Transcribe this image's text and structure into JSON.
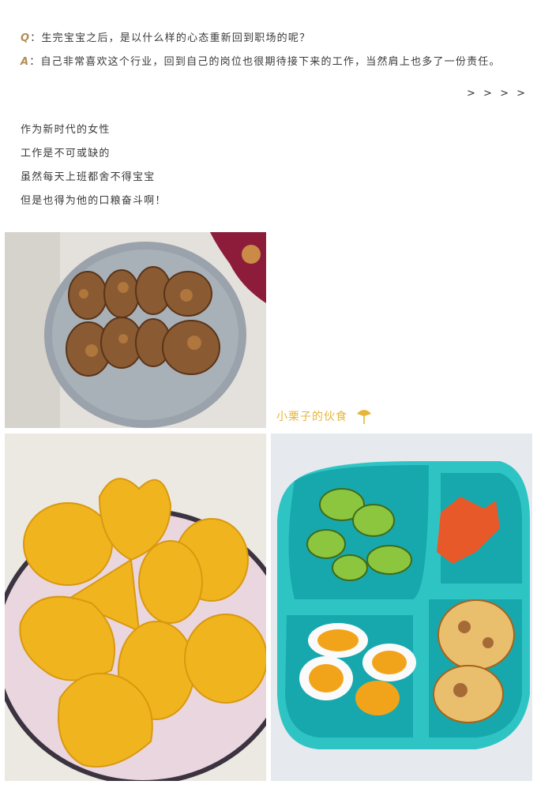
{
  "qa": {
    "q_mark": "Q",
    "q_text": "：生完宝宝之后，是以什么样的心态重新回到职场的呢？",
    "a_mark": "A",
    "a_text": "：自己非常喜欢这个行业，回到自己的岗位也很期待接下来的工作，当然肩上也多了一份责任。",
    "more": "> > > >"
  },
  "lines": [
    "作为新时代的女性",
    "工作是不可或缺的",
    "虽然每天上班都舍不得宝宝",
    "但是也得为他的口粮奋斗啊！"
  ],
  "caption": "小栗子的伙食",
  "icons": {
    "caption_icon": "ginkgo-leaf-icon"
  },
  "colors": {
    "accent": "#b38e55",
    "caption": "#e6b63a",
    "tray": "#2fc4c4"
  }
}
